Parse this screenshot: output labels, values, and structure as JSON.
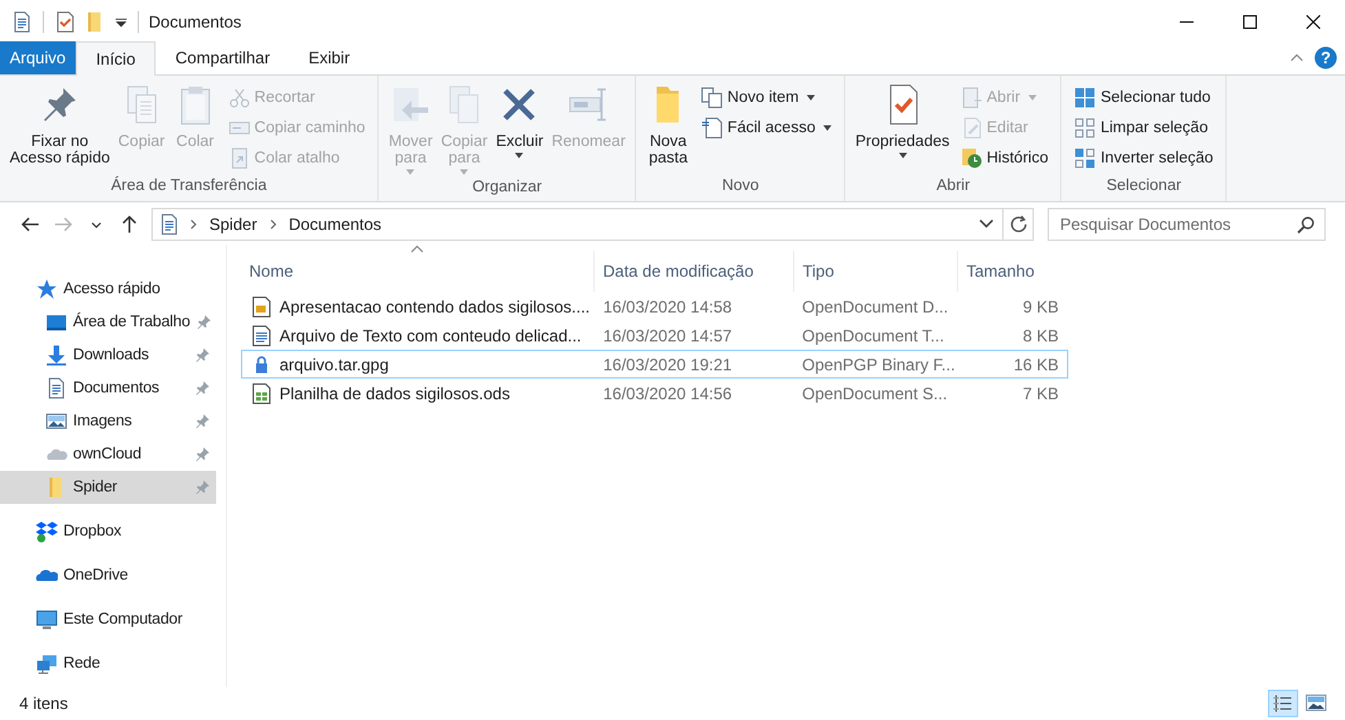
{
  "window": {
    "title": "Documentos"
  },
  "ribbon": {
    "tabs": [
      {
        "label": "Arquivo",
        "kind": "file",
        "selected": false
      },
      {
        "label": "Início",
        "kind": "tab",
        "selected": true
      },
      {
        "label": "Compartilhar",
        "kind": "tab",
        "selected": false
      },
      {
        "label": "Exibir",
        "kind": "tab",
        "selected": false
      }
    ],
    "help": {
      "label": "?"
    },
    "groups": [
      {
        "label": "Área de Transferência",
        "large": [
          {
            "label": "Fixar no\nAcesso rápido",
            "disabled": false,
            "dropdown": false
          },
          {
            "label": "Copiar",
            "disabled": true,
            "dropdown": false
          },
          {
            "label": "Colar",
            "disabled": true,
            "dropdown": false
          }
        ],
        "small": [
          {
            "label": "Recortar",
            "disabled": true,
            "dropdown": false
          },
          {
            "label": "Copiar caminho",
            "disabled": true,
            "dropdown": false
          },
          {
            "label": "Colar atalho",
            "disabled": true,
            "dropdown": false
          }
        ]
      },
      {
        "label": "Organizar",
        "large": [
          {
            "label": "Mover\npara",
            "disabled": true,
            "dropdown": true
          },
          {
            "label": "Copiar\npara",
            "disabled": true,
            "dropdown": true
          },
          {
            "label": "Excluir",
            "disabled": false,
            "dropdown": true
          },
          {
            "label": "Renomear",
            "disabled": true,
            "dropdown": false
          }
        ]
      },
      {
        "label": "Novo",
        "large": [
          {
            "label": "Nova\npasta",
            "disabled": false,
            "dropdown": false
          }
        ],
        "small": [
          {
            "label": "Novo item",
            "disabled": false,
            "dropdown": true
          },
          {
            "label": "Fácil acesso",
            "disabled": false,
            "dropdown": true
          }
        ]
      },
      {
        "label": "Abrir",
        "large": [
          {
            "label": "Propriedades",
            "disabled": false,
            "dropdown": true
          }
        ],
        "small": [
          {
            "label": "Abrir",
            "disabled": true,
            "dropdown": true
          },
          {
            "label": "Editar",
            "disabled": true,
            "dropdown": false
          },
          {
            "label": "Histórico",
            "disabled": false,
            "dropdown": false
          }
        ]
      },
      {
        "label": "Selecionar",
        "small": [
          {
            "label": "Selecionar tudo",
            "disabled": false,
            "dropdown": false
          },
          {
            "label": "Limpar seleção",
            "disabled": false,
            "dropdown": false
          },
          {
            "label": "Inverter seleção",
            "disabled": false,
            "dropdown": false
          }
        ]
      }
    ]
  },
  "navigation": {
    "buttons": [
      {
        "kind": "back",
        "disabled": false
      },
      {
        "kind": "forward",
        "disabled": true
      },
      {
        "kind": "recent",
        "disabled": false
      },
      {
        "kind": "up",
        "disabled": false
      }
    ],
    "breadcrumbs": [
      "Spider",
      "Documentos"
    ],
    "search": {
      "placeholder": "Pesquisar Documentos"
    }
  },
  "sidebar": {
    "items": [
      {
        "label": "Acesso rápido",
        "selected": false,
        "children": [
          {
            "label": "Área de Trabalho",
            "pinned": true,
            "selected": false
          },
          {
            "label": "Downloads",
            "pinned": true,
            "selected": false
          },
          {
            "label": "Documentos",
            "pinned": true,
            "selected": false
          },
          {
            "label": "Imagens",
            "pinned": true,
            "selected": false
          },
          {
            "label": "ownCloud",
            "pinned": true,
            "selected": false
          },
          {
            "label": "Spider",
            "pinned": true,
            "selected": true
          }
        ]
      },
      {
        "label": "Dropbox",
        "selected": false
      },
      {
        "label": "OneDrive",
        "selected": false
      },
      {
        "label": "Este Computador",
        "selected": false
      },
      {
        "label": "Rede",
        "selected": false
      }
    ]
  },
  "file_list": {
    "columns": [
      {
        "label": "Nome",
        "sorted": true
      },
      {
        "label": "Data de modificação",
        "sorted": false
      },
      {
        "label": "Tipo",
        "sorted": false
      },
      {
        "label": "Tamanho",
        "sorted": false
      }
    ],
    "rows": [
      {
        "name": "Apresentacao contendo dados sigilosos....",
        "modified": "16/03/2020 14:58",
        "type": "OpenDocument D...",
        "size": "9 KB",
        "focused": false
      },
      {
        "name": "Arquivo de Texto com conteudo delicad...",
        "modified": "16/03/2020 14:57",
        "type": "OpenDocument T...",
        "size": "8 KB",
        "focused": false
      },
      {
        "name": "arquivo.tar.gpg",
        "modified": "16/03/2020 19:21",
        "type": "OpenPGP Binary F...",
        "size": "16 KB",
        "focused": true
      },
      {
        "name": "Planilha de dados sigilosos.ods",
        "modified": "16/03/2020 14:56",
        "type": "OpenDocument S...",
        "size": "7 KB",
        "focused": false
      }
    ]
  },
  "status_bar": {
    "item_count": "4 itens",
    "views": [
      {
        "kind": "details",
        "selected": true
      },
      {
        "kind": "large_icons",
        "selected": false
      }
    ]
  }
}
